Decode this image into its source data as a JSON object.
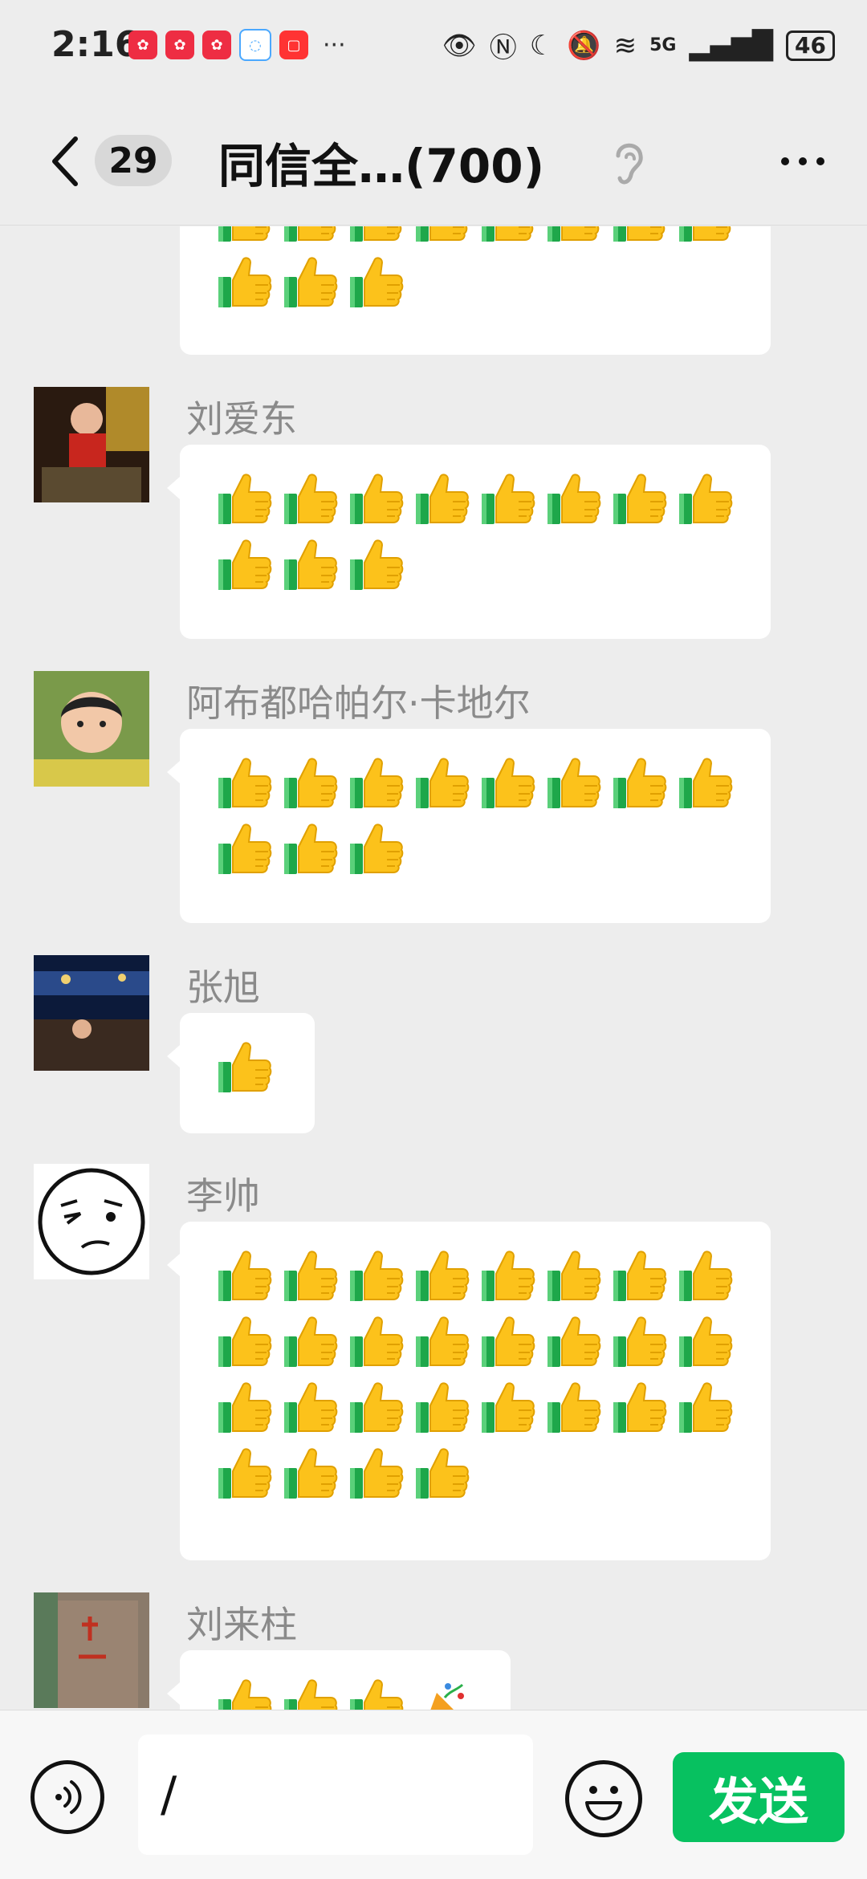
{
  "status_bar": {
    "time": "2:16",
    "network": "5G",
    "battery": "46",
    "overflow": "···"
  },
  "header": {
    "unread_count": "29",
    "title": "同信全…(700)"
  },
  "messages": [
    {
      "sender": "",
      "thumbs": 11,
      "partial_top": true
    },
    {
      "sender": "刘爱东",
      "thumbs": 11
    },
    {
      "sender": "阿布都哈帕尔·卡地尔",
      "thumbs": 11
    },
    {
      "sender": "张旭",
      "thumbs": 1
    },
    {
      "sender": "李帅",
      "thumbs": 28
    },
    {
      "sender": "刘来柱",
      "thumbs": 3,
      "extra_emoji": "party-popper-icon",
      "partial_bottom": true
    }
  ],
  "input": {
    "value": "/",
    "send_label": "发送"
  },
  "colors": {
    "send_green": "#07c160",
    "background": "#ededed",
    "bubble": "#ffffff"
  }
}
